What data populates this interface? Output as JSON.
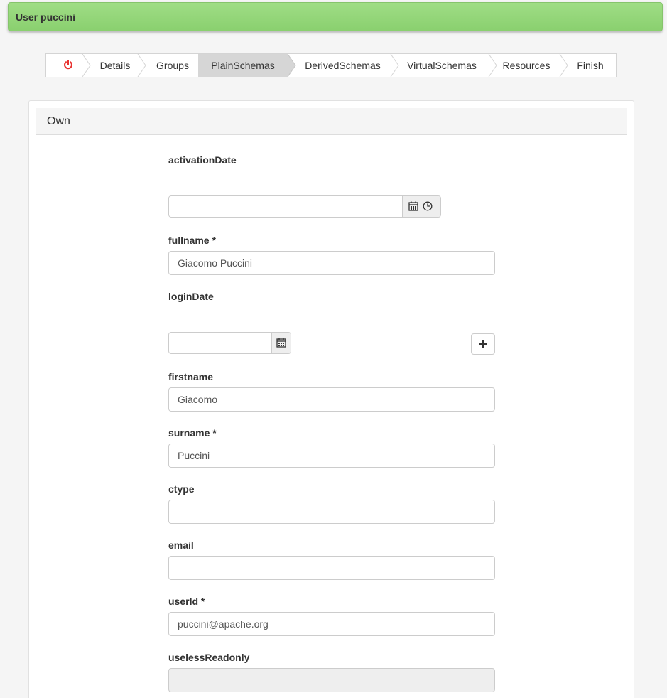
{
  "header": {
    "title": "User puccini"
  },
  "wizard": {
    "steps": [
      "Details",
      "Groups",
      "PlainSchemas",
      "DerivedSchemas",
      "VirtualSchemas",
      "Resources",
      "Finish"
    ],
    "active": "PlainSchemas",
    "power_color": "#e8312f"
  },
  "panel": {
    "title": "Own"
  },
  "fields": {
    "activationDate": {
      "label": "activationDate",
      "value": ""
    },
    "fullname": {
      "label": "fullname *",
      "value": "Giacomo Puccini"
    },
    "loginDate": {
      "label": "loginDate",
      "value": ""
    },
    "firstname": {
      "label": "firstname",
      "value": "Giacomo"
    },
    "surname": {
      "label": "surname *",
      "value": "Puccini"
    },
    "ctype": {
      "label": "ctype",
      "value": ""
    },
    "email": {
      "label": "email",
      "value": ""
    },
    "userId": {
      "label": "userId *",
      "value": "puccini@apache.org"
    },
    "uselessReadonly": {
      "label": "uselessReadonly",
      "value": ""
    }
  }
}
